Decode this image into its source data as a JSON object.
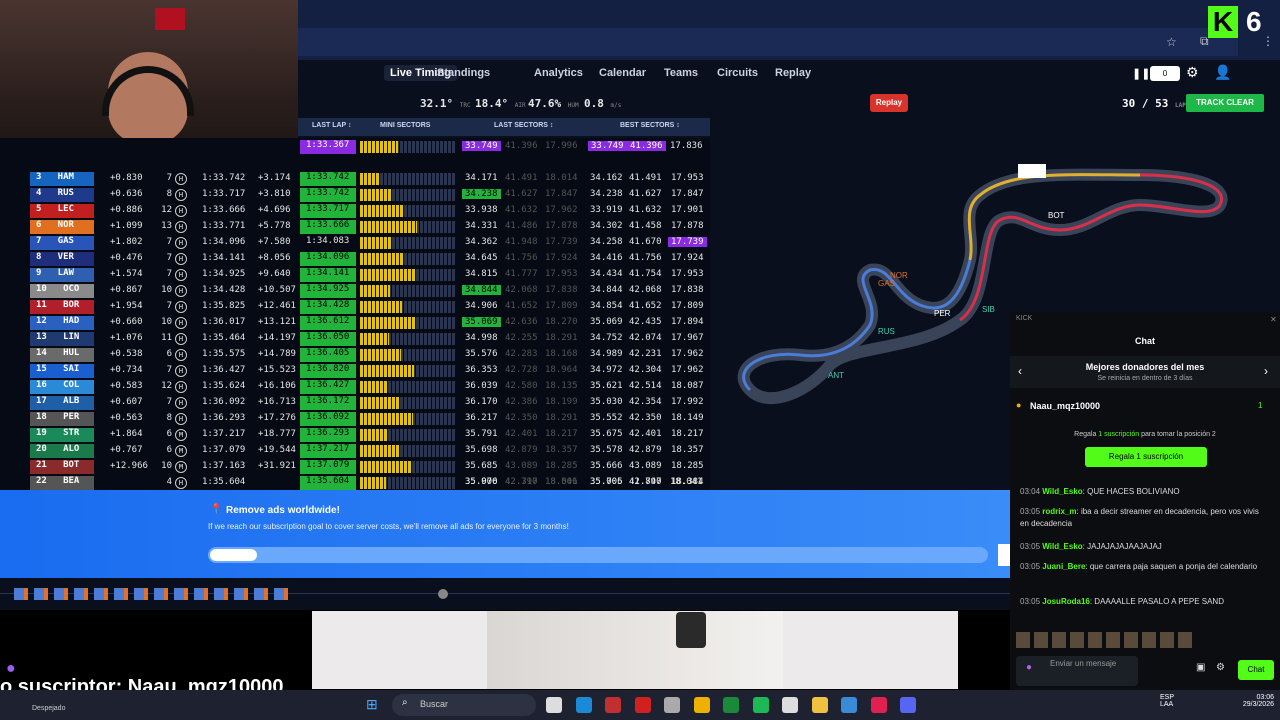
{
  "nav": {
    "items": [
      "Live Timing",
      "Standings",
      "Analytics",
      "Calendar",
      "Teams",
      "Circuits",
      "Replay"
    ]
  },
  "stats": {
    "track_temp": "32.1°",
    "track_label": "TRC",
    "air_temp": "18.4°",
    "air_label": "AIR",
    "humidity": "47.6%",
    "hum_label": "HUM",
    "wind": "0.8",
    "wind_label": "m/s"
  },
  "header": {
    "replay": "Replay",
    "lap": "30",
    "lap_total": "/ 53",
    "lap_label": "LAP",
    "track_status": "TRACK CLEAR",
    "counter": "0"
  },
  "table_headers": {
    "last_lap": "LAST LAP ↕",
    "mini": "MINI SECTORS",
    "last_sectors": "LAST SECTORS ↕",
    "best_sectors": "BEST SECTORS ↕"
  },
  "top_row": {
    "lap": "1:33.367",
    "ls1": "33.749",
    "ls2": "41.396",
    "ls3": "17.996",
    "bs1": "33.749",
    "bs2": "41.396",
    "bs3": "17.836"
  },
  "rows": [
    {
      "pos": "3",
      "code": "HAM",
      "gap": "+0.830",
      "pits": "7",
      "tyre": "H",
      "best": "1:33.742",
      "int": "+3.174",
      "last": "1:33.742",
      "ls1": "34.171",
      "ls2": "41.491",
      "ls3": "18.014",
      "bs1": "34.162",
      "bs2": "41.491",
      "bs3": "17.953"
    },
    {
      "pos": "4",
      "code": "RUS",
      "gap": "+0.636",
      "pits": "8",
      "tyre": "H",
      "best": "1:33.717",
      "int": "+3.810",
      "last": "1:33.742",
      "ls1": "34.238",
      "ls2": "41.627",
      "ls3": "17.847",
      "bs1": "34.238",
      "bs2": "41.627",
      "bs3": "17.847"
    },
    {
      "pos": "5",
      "code": "LEC",
      "gap": "+0.886",
      "pits": "12",
      "tyre": "H",
      "best": "1:33.666",
      "int": "+4.696",
      "last": "1:33.717",
      "ls1": "33.938",
      "ls2": "41.632",
      "ls3": "17.962",
      "bs1": "33.919",
      "bs2": "41.632",
      "bs3": "17.901"
    },
    {
      "pos": "6",
      "code": "NOR",
      "gap": "+1.099",
      "pits": "13",
      "tyre": "H",
      "best": "1:33.771",
      "int": "+5.778",
      "last": "1:33.666",
      "ls1": "34.331",
      "ls2": "41.486",
      "ls3": "17.878",
      "bs1": "34.302",
      "bs2": "41.458",
      "bs3": "17.878"
    },
    {
      "pos": "7",
      "code": "GAS",
      "gap": "+1.802",
      "pits": "7",
      "tyre": "H",
      "best": "1:34.096",
      "int": "+7.580",
      "last": "1:34.083",
      "ls1": "34.362",
      "ls2": "41.948",
      "ls3": "17.739",
      "bs1": "34.258",
      "bs2": "41.670",
      "bs3": "17.739"
    },
    {
      "pos": "8",
      "code": "VER",
      "gap": "+0.476",
      "pits": "7",
      "tyre": "H",
      "best": "1:34.141",
      "int": "+8.056",
      "last": "1:34.096",
      "ls1": "34.645",
      "ls2": "41.756",
      "ls3": "17.924",
      "bs1": "34.416",
      "bs2": "41.756",
      "bs3": "17.924"
    },
    {
      "pos": "9",
      "code": "LAW",
      "gap": "+1.574",
      "pits": "7",
      "tyre": "H",
      "best": "1:34.925",
      "int": "+9.640",
      "last": "1:34.141",
      "ls1": "34.815",
      "ls2": "41.777",
      "ls3": "17.953",
      "bs1": "34.434",
      "bs2": "41.754",
      "bs3": "17.953"
    },
    {
      "pos": "10",
      "code": "OCO",
      "gap": "+0.867",
      "pits": "10",
      "tyre": "H",
      "best": "1:34.428",
      "int": "+10.507",
      "last": "1:34.925",
      "ls1": "34.844",
      "ls2": "42.068",
      "ls3": "17.838",
      "bs1": "34.844",
      "bs2": "42.068",
      "bs3": "17.838"
    },
    {
      "pos": "11",
      "code": "BOR",
      "gap": "+1.954",
      "pits": "7",
      "tyre": "H",
      "best": "1:35.825",
      "int": "+12.461",
      "last": "1:34.428",
      "ls1": "34.906",
      "ls2": "41.652",
      "ls3": "17.809",
      "bs1": "34.854",
      "bs2": "41.652",
      "bs3": "17.809"
    },
    {
      "pos": "12",
      "code": "HAD",
      "gap": "+0.660",
      "pits": "10",
      "tyre": "H",
      "best": "1:36.017",
      "int": "+13.121",
      "last": "1:36.612",
      "ls1": "35.069",
      "ls2": "42.636",
      "ls3": "18.270",
      "bs1": "35.069",
      "bs2": "42.435",
      "bs3": "17.894"
    },
    {
      "pos": "13",
      "code": "LIN",
      "gap": "+1.076",
      "pits": "11",
      "tyre": "H",
      "best": "1:35.464",
      "int": "+14.197",
      "last": "1:36.050",
      "ls1": "34.998",
      "ls2": "42.255",
      "ls3": "18.291",
      "bs1": "34.752",
      "bs2": "42.074",
      "bs3": "17.967"
    },
    {
      "pos": "14",
      "code": "HUL",
      "gap": "+0.538",
      "pits": "6",
      "tyre": "H",
      "best": "1:35.575",
      "int": "+14.789",
      "last": "1:36.405",
      "ls1": "35.576",
      "ls2": "42.283",
      "ls3": "18.168",
      "bs1": "34.989",
      "bs2": "42.231",
      "bs3": "17.962"
    },
    {
      "pos": "15",
      "code": "SAI",
      "gap": "+0.734",
      "pits": "7",
      "tyre": "H",
      "best": "1:36.427",
      "int": "+15.523",
      "last": "1:36.820",
      "ls1": "36.353",
      "ls2": "42.728",
      "ls3": "18.964",
      "bs1": "34.972",
      "bs2": "42.304",
      "bs3": "17.962"
    },
    {
      "pos": "16",
      "code": "COL",
      "gap": "+0.583",
      "pits": "12",
      "tyre": "H",
      "best": "1:35.624",
      "int": "+16.106",
      "last": "1:36.427",
      "ls1": "36.039",
      "ls2": "42.580",
      "ls3": "18.135",
      "bs1": "35.621",
      "bs2": "42.514",
      "bs3": "18.087"
    },
    {
      "pos": "17",
      "code": "ALB",
      "gap": "+0.607",
      "pits": "7",
      "tyre": "H",
      "best": "1:36.092",
      "int": "+16.713",
      "last": "1:36.172",
      "ls1": "36.170",
      "ls2": "42.386",
      "ls3": "18.199",
      "bs1": "35.030",
      "bs2": "42.354",
      "bs3": "17.992"
    },
    {
      "pos": "18",
      "code": "PER",
      "gap": "+0.563",
      "pits": "8",
      "tyre": "H",
      "best": "1:36.293",
      "int": "+17.276",
      "last": "1:36.092",
      "ls1": "36.217",
      "ls2": "42.350",
      "ls3": "18.291",
      "bs1": "35.552",
      "bs2": "42.350",
      "bs3": "18.149"
    },
    {
      "pos": "19",
      "code": "STR",
      "gap": "+1.864",
      "pits": "6",
      "tyre": "M",
      "best": "1:37.217",
      "int": "+18.777",
      "last": "1:36.293",
      "ls1": "35.791",
      "ls2": "42.401",
      "ls3": "18.217",
      "bs1": "35.675",
      "bs2": "42.401",
      "bs3": "18.217"
    },
    {
      "pos": "20",
      "code": "ALO",
      "gap": "+0.767",
      "pits": "6",
      "tyre": "M",
      "best": "1:37.079",
      "int": "+19.544",
      "last": "1:37.217",
      "ls1": "35.698",
      "ls2": "42.879",
      "ls3": "18.357",
      "bs1": "35.578",
      "bs2": "42.879",
      "bs3": "18.357"
    },
    {
      "pos": "21",
      "code": "BOT",
      "gap": "+12.966",
      "pits": "10",
      "tyre": "M",
      "best": "1:37.163",
      "int": "+31.921",
      "last": "1:37.079",
      "ls1": "35.685",
      "ls2": "43.089",
      "ls3": "18.285",
      "bs1": "35.666",
      "bs2": "43.089",
      "bs3": "18.285"
    },
    {
      "pos": "22",
      "code": "BEA",
      "gap": "",
      "pits": "4",
      "tyre": "H",
      "best": "1:35.604",
      "int": "",
      "last": "1:37.203",
      "ls1": "35.900",
      "ls2": "42.797",
      "ls3": "18.506",
      "bs1": "35.705",
      "bs2": "42.797",
      "bs3": "18.384"
    }
  ],
  "bottom_row": {
    "last": "1:35.604",
    "ls1": "35.076",
    "ls2": "42.310",
    "ls3": "18.041",
    "bs1": "35.006",
    "bs2": "41.840",
    "bs3": "18.041"
  },
  "map": {
    "labels": [
      "BOT",
      "PER",
      "ANT",
      "RUS",
      "NOR",
      "GAS",
      "SIB"
    ]
  },
  "kick": {
    "letter": "K",
    "num": "6"
  },
  "chat": {
    "tag": "KICK",
    "title": "Chat",
    "donors_title": "Mejores donadores del mes",
    "donors_sub": "Se reinicia en dentro de 3 días",
    "top_donor": "Naau_mqz10000",
    "top_donor_count": "1",
    "gift_prefix": "Regala",
    "gift_strong": "1 suscripción",
    "gift_suffix": "para tomar la posición 2",
    "gift_button": "Regala 1 suscripción",
    "input_placeholder": "Enviar un mensaje",
    "send": "Chat",
    "messages": [
      {
        "time": "03:04",
        "user": "Wild_Esko",
        "text": "QUE HACES BOLIVIANO"
      },
      {
        "time": "03:05",
        "user": "rodrix_m",
        "text": "iba a decir streamer en decadencia, pero vos vivis en decadencia"
      },
      {
        "time": "03:05",
        "user": "Wild_Esko",
        "text": "JAJAJAJAJAAJAJAJ"
      },
      {
        "time": "03:05",
        "user": "Juani_Bere",
        "text": "que carrera paja saquen a ponja del calendario"
      },
      {
        "time": "03:05",
        "user": "JosuRoda16",
        "text": "DAAAALLE PASALO A PEPE SAND"
      }
    ]
  },
  "ad": {
    "title": "Remove ads worldwide!",
    "text": "If we reach our subscription goal to cover server costs, we'll remove all ads for everyone for 3 months!",
    "progress": 0.06
  },
  "overlay": {
    "subtitle": "o suscriptor: Naau_mqz10000"
  },
  "taskbar": {
    "search": "Buscar",
    "weather": "Despejado",
    "lang1": "ESP",
    "lang2": "LAA",
    "time": "03:06",
    "date": "29/3/2026"
  }
}
